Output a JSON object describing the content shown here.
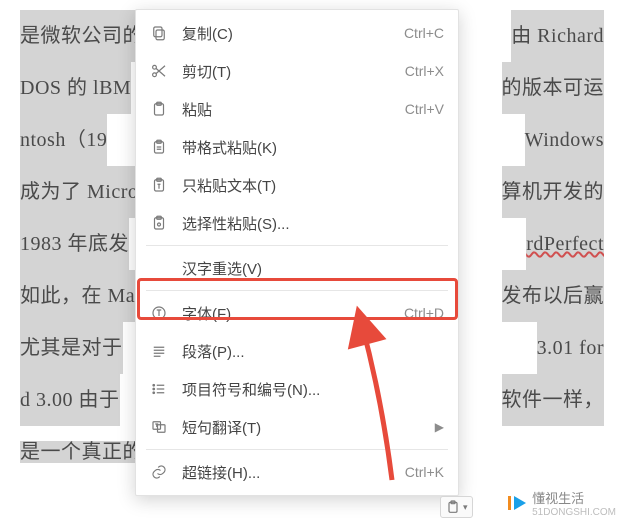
{
  "document": {
    "bg_frag_1a": "是微软公司的",
    "bg_frag_1b": "由 Richard",
    "bg_frag_2a": "DOS 的 lBM",
    "bg_frag_2b": "的版本可运",
    "bg_frag_3a": "ntosh（19",
    "bg_frag_3b": "Windows",
    "bg_frag_4a": "成为了 Micro",
    "bg_frag_4b": "算机开发的",
    "bg_frag_5a": "1983 年底发",
    "bg_frag_5b": "rdPerfect",
    "bg_frag_6a": "如此，在 Ma",
    "bg_frag_6b": "发布以后赢",
    "bg_frag_7a": "尤其是对于",
    "bg_frag_7b": "3.01 for",
    "bg_frag_8a": "d 3.00 由于",
    "bg_frag_8b": "软件一样，",
    "bg_frag_9": "是一个真正的（所见即所得）编辑器。"
  },
  "menu": {
    "copy": {
      "label": "复制(C)",
      "shortcut": "Ctrl+C"
    },
    "cut": {
      "label": "剪切(T)",
      "shortcut": "Ctrl+X"
    },
    "paste": {
      "label": "粘贴",
      "shortcut": "Ctrl+V"
    },
    "paste_fmt": {
      "label": "带格式粘贴(K)",
      "shortcut": ""
    },
    "paste_text": {
      "label": "只粘贴文本(T)",
      "shortcut": ""
    },
    "paste_sel": {
      "label": "选择性粘贴(S)...",
      "shortcut": ""
    },
    "hanzi": {
      "label": "汉字重选(V)",
      "shortcut": ""
    },
    "font": {
      "label": "字体(F)...",
      "shortcut": "Ctrl+D"
    },
    "para": {
      "label": "段落(P)...",
      "shortcut": ""
    },
    "bullets": {
      "label": "项目符号和编号(N)...",
      "shortcut": ""
    },
    "translate": {
      "label": "短句翻译(T)",
      "shortcut": ""
    },
    "hyperlink": {
      "label": "超链接(H)...",
      "shortcut": "Ctrl+K"
    }
  },
  "watermark": {
    "brand": "懂视生活",
    "domain": "51DONGSHI.COM"
  },
  "colors": {
    "highlight": "#e74a3b",
    "arrow": "#e74a3b"
  }
}
